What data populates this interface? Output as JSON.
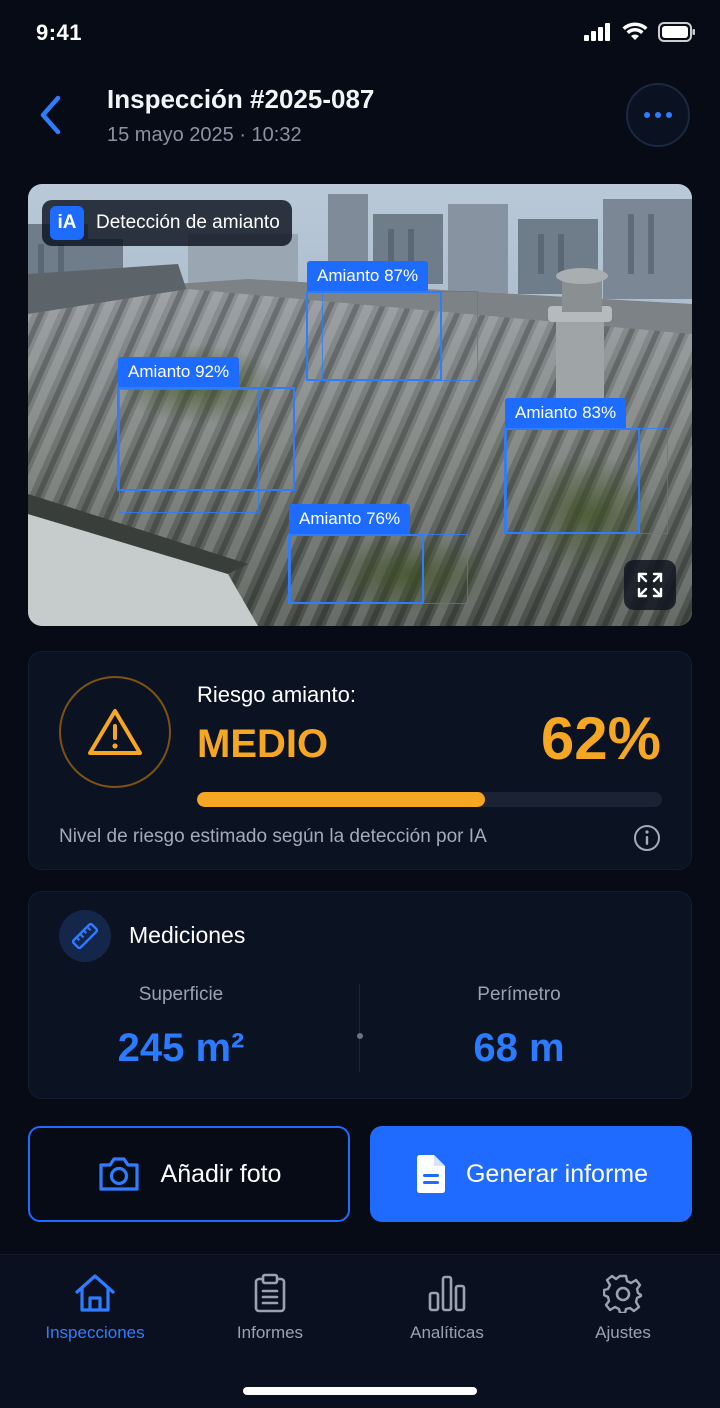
{
  "status_bar": {
    "time": "9:41"
  },
  "header": {
    "title": "Inspección #2025-087",
    "subtitle": "15 mayo 2025 · 10:32"
  },
  "photo": {
    "badge_logo": "iA",
    "badge_text": "Detección de amianto",
    "detections": [
      {
        "label": "Amianto 87%"
      },
      {
        "label": "Amianto 92%"
      },
      {
        "label": "Amianto 83%"
      },
      {
        "label": "Amianto 76%"
      }
    ]
  },
  "risk": {
    "label": "Riesgo amianto:",
    "level": "MEDIO",
    "percent_text": "62%",
    "progress_fraction": 0.62,
    "note": "Nivel de riesgo estimado según la detección por IA",
    "accent_color": "#f5a623"
  },
  "measurements": {
    "title": "Mediciones",
    "surface_label": "Superficie",
    "surface_value": "245 m²",
    "perimeter_label": "Perímetro",
    "perimeter_value": "68 m"
  },
  "actions": {
    "add_photo": "Añadir foto",
    "generate_report": "Generar informe"
  },
  "tabs": [
    {
      "label": "Inspecciones",
      "icon": "home-icon",
      "active": true
    },
    {
      "label": "Informes",
      "icon": "clipboard-icon",
      "active": false
    },
    {
      "label": "Analíticas",
      "icon": "bar-chart-icon",
      "active": false
    },
    {
      "label": "Ajustes",
      "icon": "gear-icon",
      "active": false
    }
  ],
  "colors": {
    "primary": "#1f6bff",
    "background": "#060b16",
    "warning": "#f5a623"
  }
}
